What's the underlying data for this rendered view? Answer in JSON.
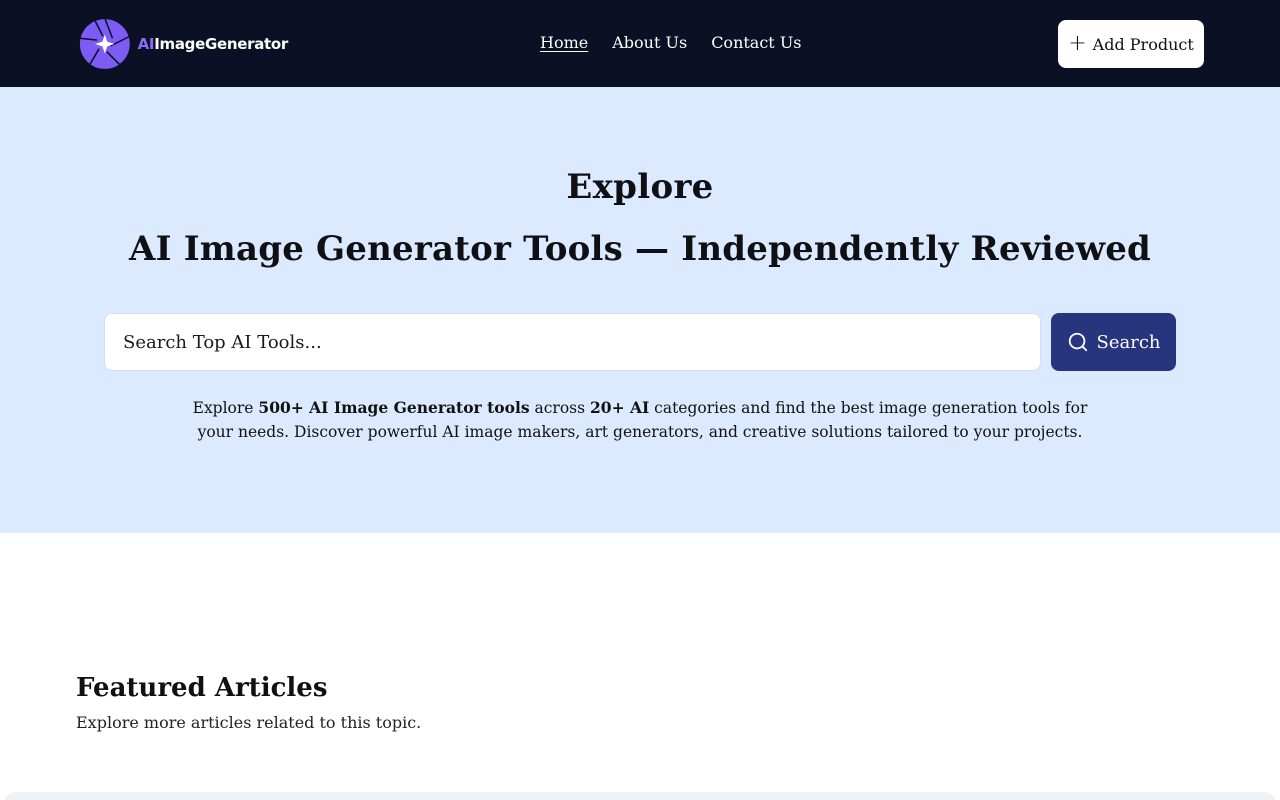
{
  "header": {
    "logo_prefix": "AI",
    "logo_suffix": "ImageGenerator",
    "nav": [
      {
        "label": "Home",
        "active": true
      },
      {
        "label": "About Us",
        "active": false
      },
      {
        "label": "Contact Us",
        "active": false
      }
    ],
    "add_button_icon": "plus-icon",
    "add_button_label": "Add Product"
  },
  "hero": {
    "title_line1": "Explore",
    "title_line2": "AI Image Generator Tools — Independently Reviewed",
    "search_placeholder": "Search Top AI Tools...",
    "search_button_label": "Search",
    "description": {
      "t1": "Explore ",
      "b1": "500+ AI Image Generator tools",
      "t2": " across ",
      "b2": "20+ AI",
      "t3": " categories and find the best image generation tools for your needs. Discover powerful AI image makers, art generators, and creative solutions tailored to your projects."
    }
  },
  "featured": {
    "title": "Featured Articles",
    "subtitle": "Explore more articles related to this topic."
  },
  "colors": {
    "header_bg": "#0b1025",
    "hero_bg": "#dbeafe",
    "accent": "#27357f",
    "logo_purple": "#7c5cf5"
  }
}
